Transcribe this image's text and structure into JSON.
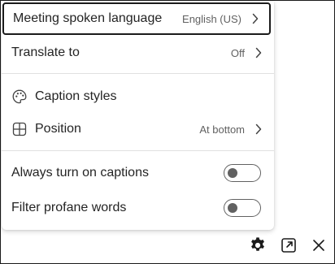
{
  "menu": {
    "items": [
      {
        "label": "Meeting spoken language",
        "value": "English (US)",
        "has_chevron": true
      },
      {
        "label": "Translate to",
        "value": "Off",
        "has_chevron": true
      },
      {
        "label": "Caption styles",
        "icon": "palette-icon"
      },
      {
        "label": "Position",
        "value": "At bottom",
        "icon": "grid-icon",
        "has_chevron": true
      }
    ],
    "toggles": [
      {
        "label": "Always turn on captions",
        "on": false
      },
      {
        "label": "Filter profane words",
        "on": false
      }
    ]
  },
  "bottom_bar": {
    "icons": [
      "gear-icon",
      "pop-out-icon",
      "close-icon"
    ]
  },
  "colors": {
    "text": "#242424",
    "secondary_text": "#616161",
    "divider": "#e0e0e0",
    "toggle_off": "#616161"
  }
}
